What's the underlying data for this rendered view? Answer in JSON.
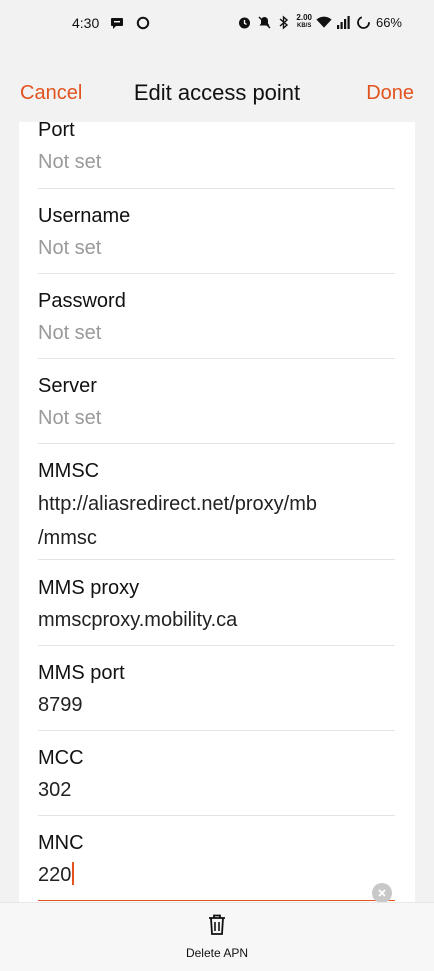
{
  "status": {
    "time": "4:30",
    "net_speed_value": "2.00",
    "net_speed_unit": "KB/S",
    "battery": "66%"
  },
  "toolbar": {
    "cancel": "Cancel",
    "title": "Edit access point",
    "done": "Done"
  },
  "fields": [
    {
      "label": "Port",
      "value": "Not set"
    },
    {
      "label": "Username",
      "value": "Not set"
    },
    {
      "label": "Password",
      "value": "Not set"
    },
    {
      "label": "Server",
      "value": "Not set"
    },
    {
      "label": "MMSC",
      "value_line1": "http://aliasredirect.net/proxy/mb",
      "value_line2": "/mmsc"
    },
    {
      "label": "MMS proxy",
      "value": "mmscproxy.mobility.ca"
    },
    {
      "label": "MMS port",
      "value": "8799"
    },
    {
      "label": "MCC",
      "value": "302"
    },
    {
      "label": "MNC",
      "value": "220"
    }
  ],
  "bottom": {
    "delete": "Delete APN"
  },
  "icons": {
    "status": [
      "message-icon",
      "circle-icon",
      "alarm-icon",
      "mute-icon",
      "bluetooth-icon",
      "wifi-icon",
      "signal-icon",
      "battery-icon"
    ],
    "clear": "clear-icon",
    "delete": "trash-icon"
  },
  "colors": {
    "accent": "#e2531f",
    "placeholder": "#9a9a9a"
  }
}
